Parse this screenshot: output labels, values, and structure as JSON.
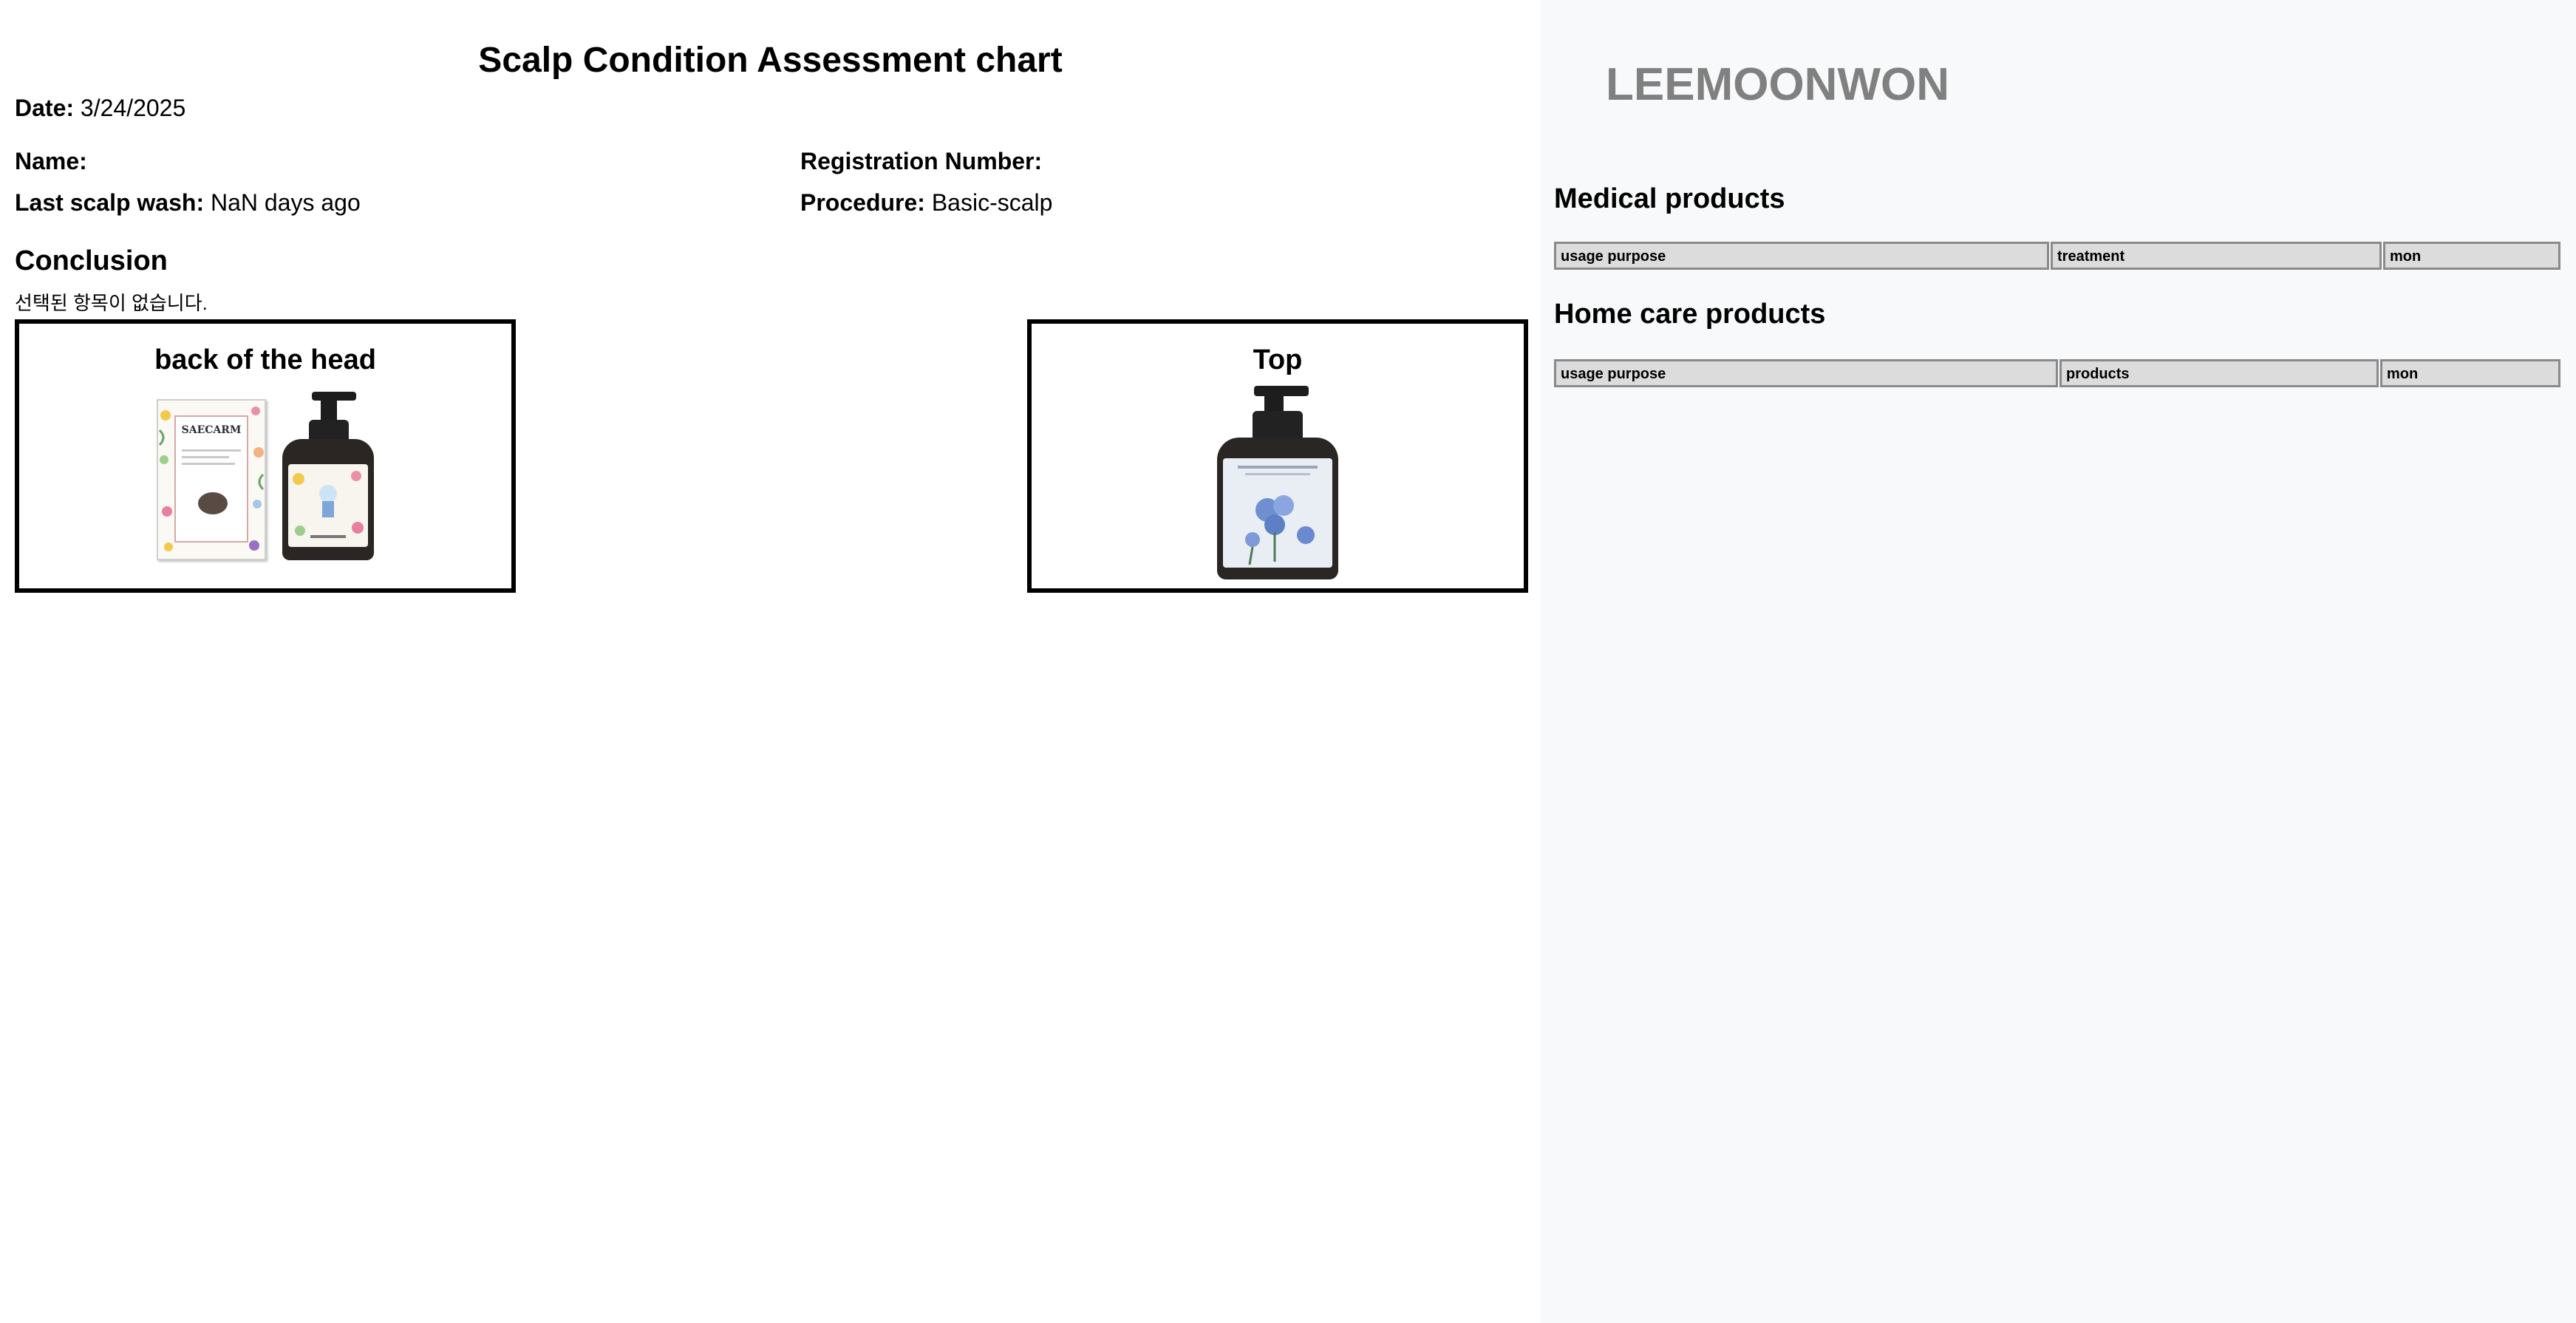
{
  "chart_form": {
    "title": "Scalp Condition Assessment chart",
    "date_label": "Date:",
    "date_value": "3/24/2025",
    "name_label": "Name:",
    "name_value": "",
    "registration_label": "Registration Number:",
    "registration_value": "",
    "last_wash_label": "Last scalp wash:",
    "last_wash_value": "NaN days ago",
    "procedure_label": "Procedure:",
    "procedure_value": "Basic-scalp"
  },
  "conclusion": {
    "title": "Conclusion",
    "text": "선택된 항목이 없습니다."
  },
  "regions": [
    {
      "title": "back of the head",
      "products": [
        "safecarm-pack-image",
        "shampoo-bottle-image"
      ]
    },
    {
      "title": "Top",
      "products": [
        "shampoo-bottle-blue-image"
      ]
    }
  ],
  "product_art": {
    "pack_brand": "SAECARM"
  },
  "side_panel": {
    "brand": "LEEMOONWON",
    "medical": {
      "title": "Medical products",
      "columns": [
        "usage purpose",
        "treatment",
        "mon"
      ]
    },
    "home_care": {
      "title": "Home care products",
      "columns": [
        "usage purpose",
        "products",
        "mon"
      ]
    }
  },
  "colors": {
    "side_bg": "#f8f9fa",
    "brand_gray": "#808080",
    "table_header_bg": "#dcdcdc",
    "table_border": "#8a8a8a"
  }
}
